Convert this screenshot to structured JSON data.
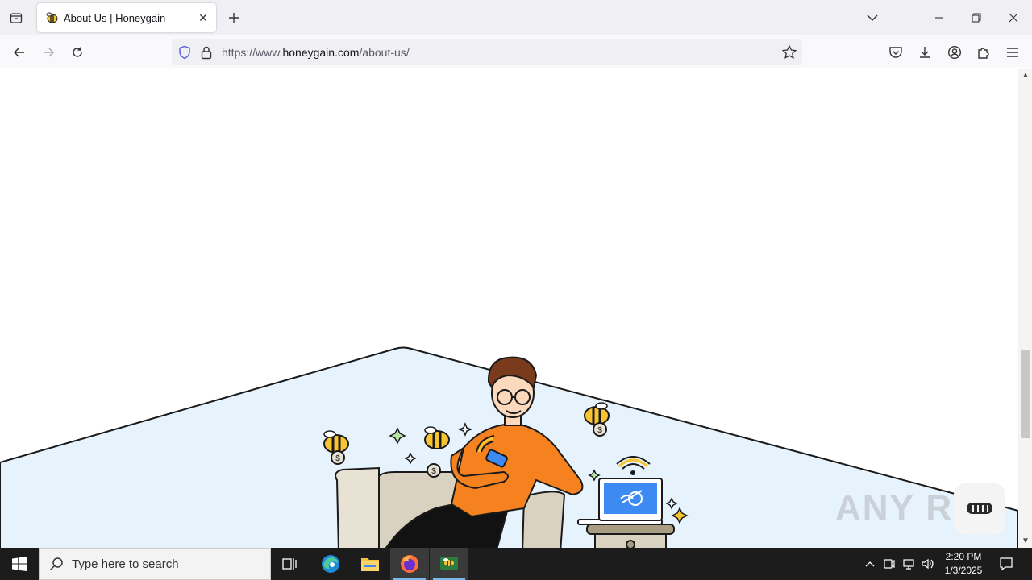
{
  "browser": {
    "tab": {
      "title": "About Us | Honeygain",
      "favicon": "honeygain-bee-icon"
    },
    "url": {
      "prefix": "https://www.",
      "host": "honeygain.com",
      "path": "/about-us/"
    }
  },
  "page": {
    "illustration": "person-on-armchair-with-bees-and-laptop",
    "watermark": "ANY RUN",
    "colors": {
      "backdrop": "#e6f2fc",
      "shirt": "#f5821f",
      "bee_yellow": "#f9c431",
      "laptop_screen": "#3d8bf2"
    }
  },
  "taskbar": {
    "search_placeholder": "Type here to search",
    "clock_time": "2:20 PM",
    "clock_date": "1/3/2025"
  }
}
